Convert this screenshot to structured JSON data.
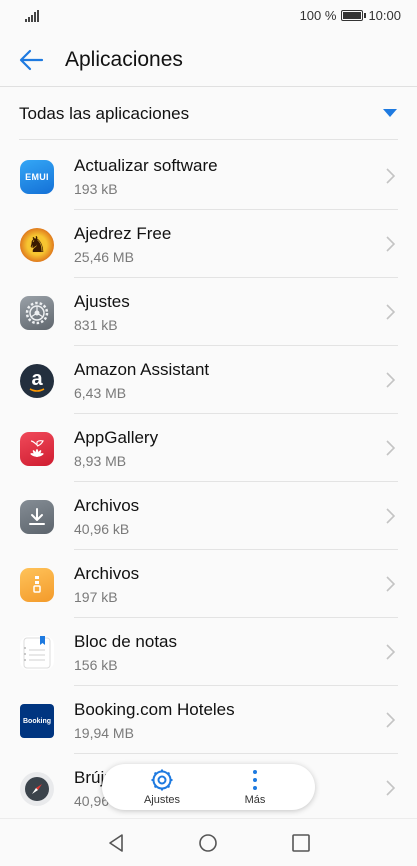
{
  "status_bar": {
    "battery": "100 %",
    "time": "10:00"
  },
  "header": {
    "title": "Aplicaciones"
  },
  "filter": {
    "label": "Todas las aplicaciones"
  },
  "apps": [
    {
      "name": "Actualizar software",
      "size": "193 kB",
      "icon": "emui-icon",
      "icon_text": "EMUI",
      "color": "#1e8ee8"
    },
    {
      "name": "Ajedrez Free",
      "size": "25,46 MB",
      "icon": "chess-icon",
      "icon_text": "♞",
      "color": "#c8320a"
    },
    {
      "name": "Ajustes",
      "size": "831 kB",
      "icon": "gear-icon",
      "icon_text": "",
      "color": "#7d858d"
    },
    {
      "name": "Amazon Assistant",
      "size": "6,43 MB",
      "icon": "amazon-icon",
      "icon_text": "a",
      "color": "#232f3e"
    },
    {
      "name": "AppGallery",
      "size": "8,93 MB",
      "icon": "appgallery-icon",
      "icon_text": "",
      "color": "#e0283a"
    },
    {
      "name": "Archivos",
      "size": "40,96 kB",
      "icon": "download-icon",
      "icon_text": "",
      "color": "#6f7780"
    },
    {
      "name": "Archivos",
      "size": "197 kB",
      "icon": "folder-icon",
      "icon_text": "",
      "color": "#f6a83a"
    },
    {
      "name": "Bloc de notas",
      "size": "156 kB",
      "icon": "notepad-icon",
      "icon_text": "",
      "color": "#ffffff"
    },
    {
      "name": "Booking.com Hoteles",
      "size": "19,94 MB",
      "icon": "booking-icon",
      "icon_text": "Booking",
      "color": "#003580"
    },
    {
      "name": "Brújula",
      "size": "40,96 kB",
      "icon": "compass-icon",
      "icon_text": "",
      "color": "#e9eaec"
    }
  ],
  "floating_menu": {
    "settings_label": "Ajustes",
    "more_label": "Más"
  },
  "colors": {
    "accent": "#1e7ae0"
  }
}
